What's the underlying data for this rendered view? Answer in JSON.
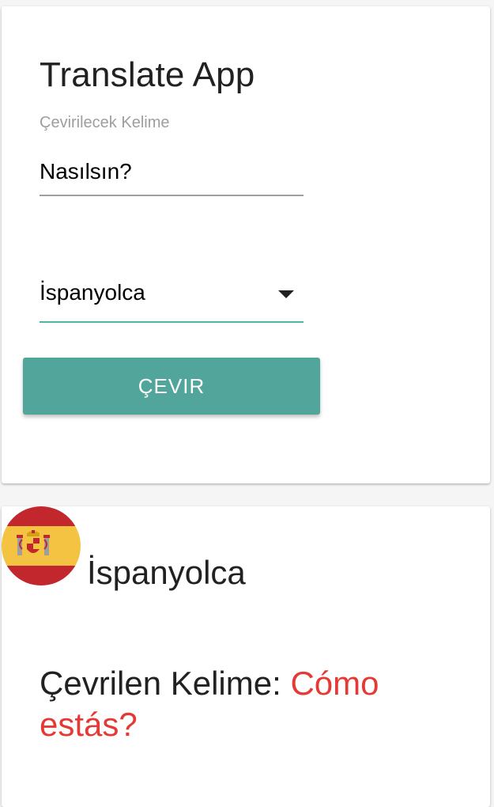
{
  "app": {
    "title": "Translate App"
  },
  "form": {
    "input_label": "Çevirilecek Kelime",
    "input_value": "Nasılsın?",
    "language_selected": "İspanyolca",
    "translate_button_label": "ÇEVIR"
  },
  "result": {
    "flag_icon": "spain-flag-icon",
    "language": "İspanyolca",
    "prefix_label": "Çevrilen Kelime:",
    "translated_word": "Cómo estás?"
  },
  "colors": {
    "accent": "#52a59b",
    "select_underline": "#4db6ac",
    "result_word": "#e53935",
    "flag_red": "#c1272d",
    "flag_yellow": "#f4c342"
  }
}
